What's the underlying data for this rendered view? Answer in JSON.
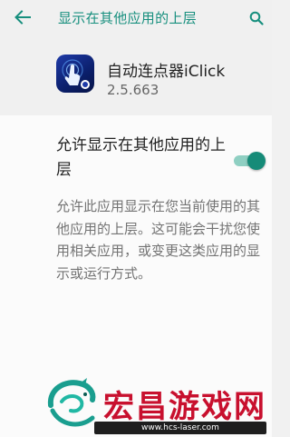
{
  "toolbar": {
    "back_icon": "arrow-left-icon",
    "title": "显示在其他应用的上层",
    "search_icon": "search-icon"
  },
  "app": {
    "icon": "tap-finger-app-icon",
    "name": "自动连点器iClick",
    "version": "2.5.663"
  },
  "setting": {
    "label": "允许显示在其他应用的上层",
    "enabled": true,
    "description": "允许此应用显示在您当前使用的其他应用的上层。这可能会干扰您使用相关应用，或变更这类应用的显示或运行方式。"
  },
  "watermark": {
    "title": "宏昌游戏网",
    "url": "www.hcs-laser.com"
  },
  "colors": {
    "accent": "#178f7e",
    "toggle_thumb": "#168b78",
    "toggle_track": "#8fcfc2",
    "watermark_red": "#c8102e",
    "watermark_teal": "#1a9e8f"
  }
}
